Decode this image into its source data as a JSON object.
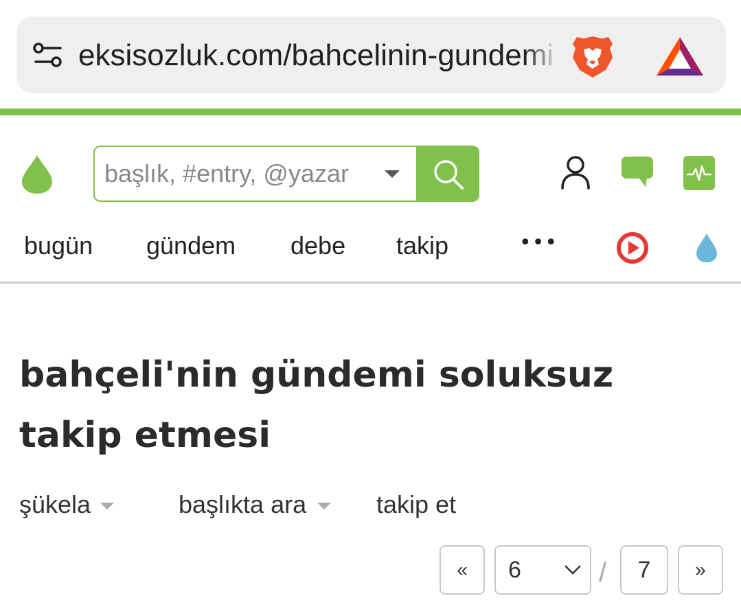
{
  "browser": {
    "url": "eksisozluk.com/bahcelinin-gundemi-soluksuz-takip-etmesi",
    "icons": [
      "tune-icon",
      "brave-lion-icon",
      "bat-triangle-icon"
    ]
  },
  "colors": {
    "brand_green": "#81c14b",
    "nav_rule": "#c8d0d4",
    "play_red": "#e53935",
    "drop_blue": "#6ab8d8"
  },
  "header": {
    "search": {
      "placeholder": "başlık, #entry, @yazar"
    },
    "icons": [
      "eksi-drop-logo",
      "search-icon",
      "user-icon",
      "message-icon",
      "activity-icon"
    ]
  },
  "nav": {
    "items": [
      {
        "label": "bugün"
      },
      {
        "label": "gündem"
      },
      {
        "label": "debe"
      },
      {
        "label": "takip"
      }
    ],
    "more_label": "•••"
  },
  "topic": {
    "title": "bahçeli'nin gündemi soluksuz takip etmesi"
  },
  "actions": {
    "sort_label": "şükela",
    "search_in_title_label": "başlıkta ara",
    "follow_label": "takip et"
  },
  "pager": {
    "prev_label": "«",
    "current_page": "6",
    "separator": "/",
    "total_pages": "7",
    "next_label": "»"
  }
}
